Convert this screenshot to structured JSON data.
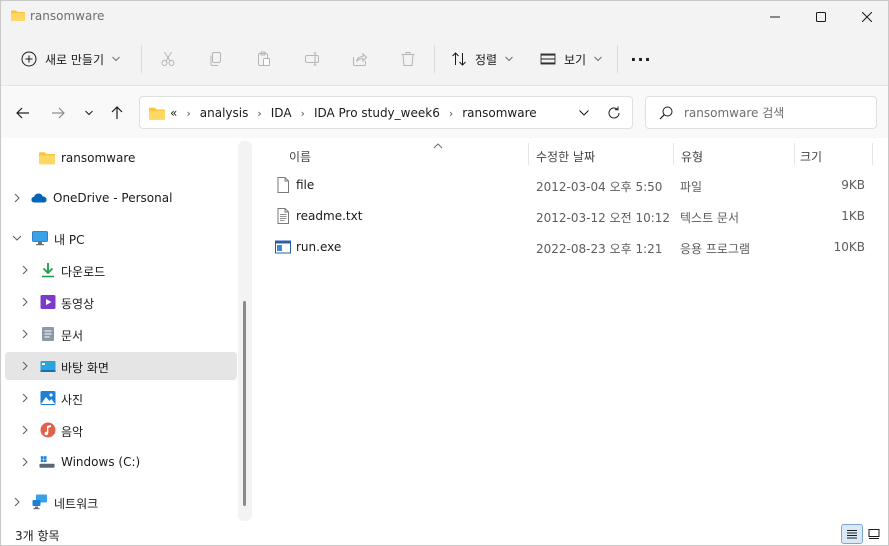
{
  "window": {
    "title": "ransomware"
  },
  "toolbar": {
    "new_label": "새로 만들기",
    "sort_label": "정렬",
    "view_label": "보기",
    "more_label": "···"
  },
  "address": {
    "overflow": "«",
    "crumbs": [
      "analysis",
      "IDA",
      "IDA Pro study_week6",
      "ransomware"
    ]
  },
  "search": {
    "placeholder": "ransomware 검색"
  },
  "sidebar": {
    "items": [
      {
        "label": "ransomware"
      },
      {
        "label": "OneDrive - Personal"
      },
      {
        "label": "내 PC"
      },
      {
        "label": "다운로드"
      },
      {
        "label": "동영상"
      },
      {
        "label": "문서"
      },
      {
        "label": "바탕 화면"
      },
      {
        "label": "사진"
      },
      {
        "label": "음악"
      },
      {
        "label": "Windows (C:)"
      },
      {
        "label": "네트워크"
      }
    ]
  },
  "columns": {
    "name": "이름",
    "date": "수정한 날짜",
    "type": "유형",
    "size": "크기"
  },
  "files": [
    {
      "name": "file",
      "date": "2012-03-04 오후 5:50",
      "type": "파일",
      "size": "9KB",
      "icon": "blank-file-icon"
    },
    {
      "name": "readme.txt",
      "date": "2012-03-12 오전 10:12",
      "type": "텍스트 문서",
      "size": "1KB",
      "icon": "text-file-icon"
    },
    {
      "name": "run.exe",
      "date": "2022-08-23 오후 1:21",
      "type": "응용 프로그램",
      "size": "10KB",
      "icon": "application-icon"
    }
  ],
  "status": {
    "item_count": "3개 항목"
  },
  "colors": {
    "accent": "#0067c0",
    "folder": "#f8c43a",
    "selected_bg": "#e5e5e5"
  }
}
